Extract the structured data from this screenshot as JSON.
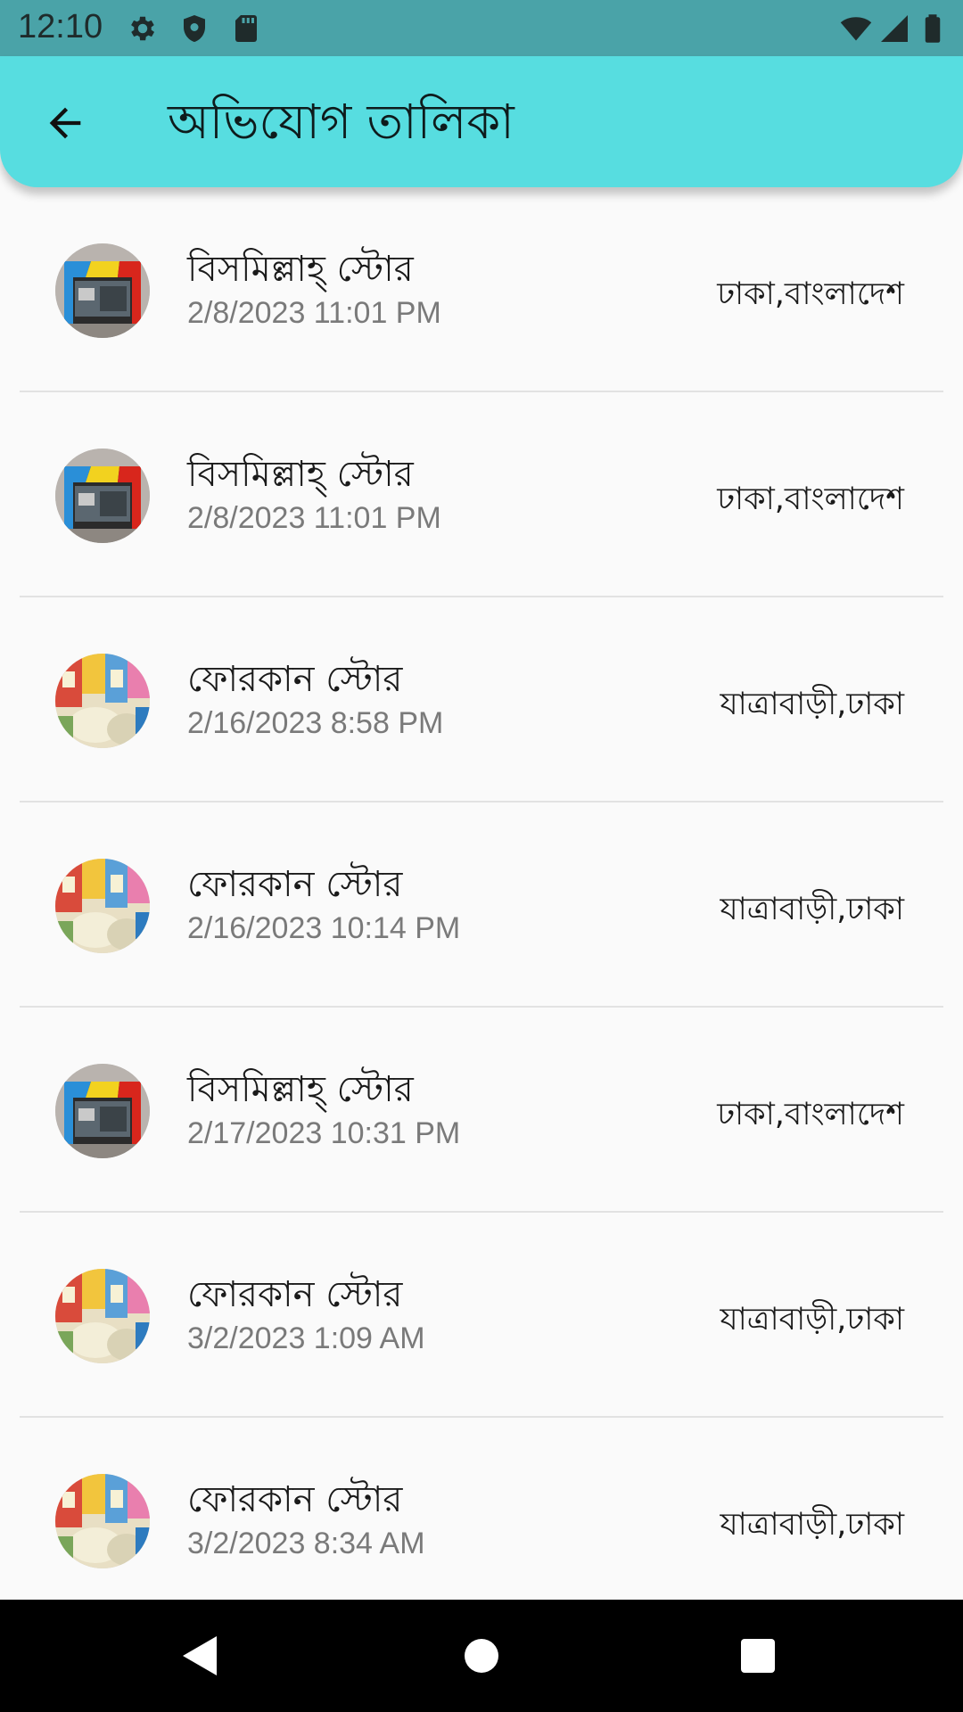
{
  "status_bar": {
    "time": "12:10",
    "left_icons": [
      "gear-icon",
      "shield-icon",
      "sd-card-icon"
    ],
    "right_icons": [
      "wifi-icon",
      "signal-icon",
      "battery-icon"
    ]
  },
  "app_bar": {
    "title": "অভিযোগ তালিকা",
    "back_icon": "arrow-back-icon",
    "background_color": "#57dde0"
  },
  "complaints": [
    {
      "store": "বিসমিল্লাহ্ স্টোর",
      "datetime": "2/8/2023 11:01 PM",
      "location": "ঢাকা,বাংলাদেশ",
      "avatar": "storefront-photo"
    },
    {
      "store": "বিসমিল্লাহ্ স্টোর",
      "datetime": "2/8/2023 11:01 PM",
      "location": "ঢাকা,বাংলাদেশ",
      "avatar": "storefront-photo"
    },
    {
      "store": "ফোরকান স্টোর",
      "datetime": "2/16/2023 8:58 PM",
      "location": "যাত্রাবাড়ী,ঢাকা",
      "avatar": "grocery-photo"
    },
    {
      "store": "ফোরকান স্টোর",
      "datetime": "2/16/2023 10:14 PM",
      "location": "যাত্রাবাড়ী,ঢাকা",
      "avatar": "grocery-photo"
    },
    {
      "store": "বিসমিল্লাহ্ স্টোর",
      "datetime": "2/17/2023 10:31 PM",
      "location": "ঢাকা,বাংলাদেশ",
      "avatar": "storefront-photo"
    },
    {
      "store": "ফোরকান স্টোর",
      "datetime": "3/2/2023 1:09 AM",
      "location": "যাত্রাবাড়ী,ঢাকা",
      "avatar": "grocery-photo"
    },
    {
      "store": "ফোরকান স্টোর",
      "datetime": "3/2/2023 8:34 AM",
      "location": "যাত্রাবাড়ী,ঢাকা",
      "avatar": "grocery-photo"
    }
  ],
  "nav_bar": {
    "buttons": [
      "back-triangle-icon",
      "home-circle-icon",
      "recents-square-icon"
    ]
  }
}
